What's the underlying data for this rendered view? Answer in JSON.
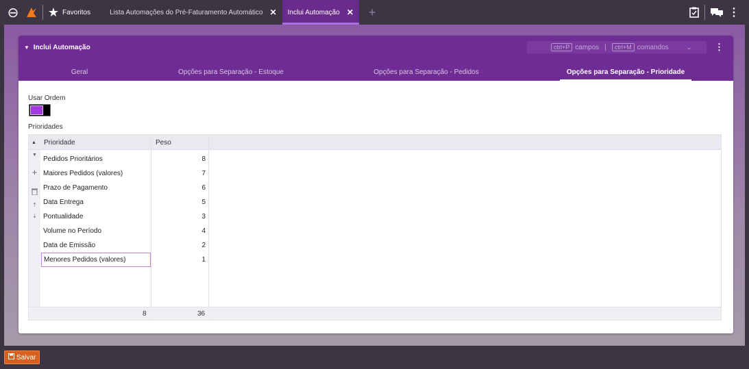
{
  "topbar": {
    "favorites_label": "Favoritos",
    "tabs": [
      {
        "label": "Lista Automações do Pré-Faturamento Automático",
        "close": "✕"
      },
      {
        "label": "Inclui Automação",
        "close": "✕"
      }
    ],
    "add_tab": "+",
    "back_icon": "⊖",
    "star_icon": "★",
    "clipboard_icon": "📋",
    "chat_icon": "💬",
    "menu_icon": "⋮"
  },
  "panel": {
    "title": "Inclui Automação",
    "caret": "▼",
    "shortcuts": {
      "key1": "ctrl+P",
      "label1": "campos",
      "divider": "|",
      "key2": "ctrl+M",
      "label2": "comandos",
      "chevron": "⌄"
    },
    "menu_icon": "⋮",
    "tabs": [
      {
        "label": "Geral"
      },
      {
        "label": "Opções para Separação - Estoque"
      },
      {
        "label": "Opções para Separação - Pedidos"
      },
      {
        "label": "Opções para Separação - Prioridade"
      }
    ]
  },
  "form": {
    "use_order_label": "Usar Ordem",
    "use_order_value": true,
    "priorities_label": "Prioridades"
  },
  "grid": {
    "columns": {
      "col1": "Prioridade",
      "col2": "Peso"
    },
    "sort_icon": "▲",
    "rows": [
      {
        "name": "Pedidos Prioritários",
        "weight": "8"
      },
      {
        "name": "Maiores Pedidos (valores)",
        "weight": "7"
      },
      {
        "name": "Prazo de Pagamento",
        "weight": "6"
      },
      {
        "name": "Data Entrega",
        "weight": "5"
      },
      {
        "name": "Pontualidade",
        "weight": "3"
      },
      {
        "name": "Volume no Período",
        "weight": "4"
      },
      {
        "name": "Data de Emissão",
        "weight": "2"
      },
      {
        "name": "Menores Pedidos (valores)",
        "weight": "1"
      }
    ],
    "side_icons": {
      "down": "▼",
      "add": "+",
      "delete": "🗑",
      "move_up": "⇡",
      "move_down": "⇣"
    },
    "footer": {
      "count": "8",
      "sum": "36"
    }
  },
  "bottom": {
    "save_label": "Salvar",
    "save_icon": "💾"
  }
}
